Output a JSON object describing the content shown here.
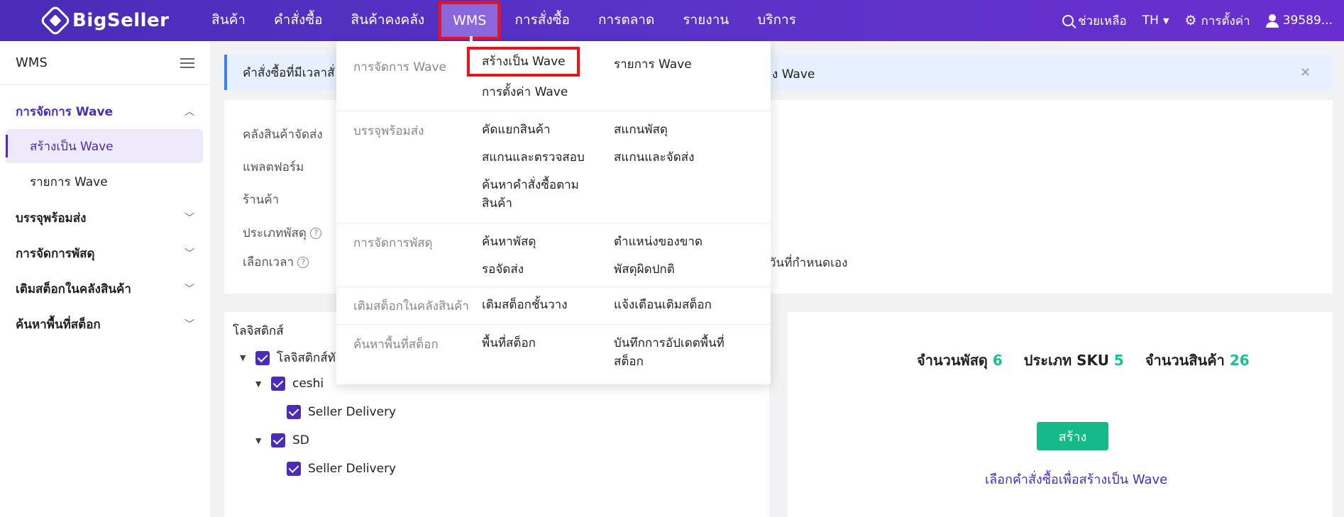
{
  "brand": "BigSeller",
  "nav": {
    "items": [
      "สินค้า",
      "คำสั่งซื้อ",
      "สินค้าคงคลัง",
      "WMS",
      "การสั่งซื้อ",
      "การตลาด",
      "รายงาน",
      "บริการ"
    ],
    "active": "WMS"
  },
  "topright": {
    "help": "ช่วยเหลือ",
    "lang": "TH",
    "settings": "การตั้งค่า",
    "user": "39589..."
  },
  "sidebar": {
    "title": "WMS",
    "groups": [
      {
        "label": "การจัดการ Wave",
        "open": true,
        "items": [
          "สร้างเป็น Wave",
          "รายการ Wave"
        ]
      },
      {
        "label": "บรรจุพร้อมส่ง"
      },
      {
        "label": "การจัดการพัสดุ"
      },
      {
        "label": "เติมสต็อกในคลังสินค้า"
      },
      {
        "label": "ค้นหาพื้นที่สต็อก"
      }
    ],
    "active_item": "สร้างเป็น Wave"
  },
  "alert": {
    "text": "คำสั่งซื้อที่มีเวลาสั่",
    "tail": "ง Wave"
  },
  "filters": {
    "warehouse": "คลังสินค้าจัดส่ง",
    "platform": "แพลตฟอร์ม",
    "shop": "ร้านค้า",
    "parcel_type": "ประเภทพัสดุ",
    "time": "เลือกเวลา",
    "custom_date": "วันที่กำหนดเอง"
  },
  "logistics": {
    "title": "โลจิสติกส์",
    "root": "โลจิสติกส์ทั",
    "carriers": [
      {
        "name": "ceshi",
        "child": "Seller Delivery"
      },
      {
        "name": "SD",
        "child": "Seller Delivery"
      }
    ]
  },
  "summary": {
    "parcels_label": "จำนวนพัสดุ",
    "parcels": "6",
    "sku_label": "ประเภท SKU",
    "sku": "5",
    "qty_label": "จำนวนสินค้า",
    "qty": "26",
    "create_button": "สร้าง",
    "hint": "เลือกคำสั่งซื้อเพื่อสร้างเป็น Wave"
  },
  "dropdown": {
    "sections": [
      {
        "category": "การจัดการ Wave",
        "links": [
          "สร้างเป็น Wave",
          "รายการ Wave",
          "การตั้งค่า Wave"
        ]
      },
      {
        "category": "บรรจุพร้อมส่ง",
        "links": [
          "คัดแยกสินค้า",
          "สแกนพัสดุ",
          "สแกนและตรวจสอบ",
          "สแกนและจัดส่ง",
          "ค้นหาคำสั่งซื้อตาม",
          "สินค้า"
        ]
      },
      {
        "category": "การจัดการพัสดุ",
        "links": [
          "ค้นหาพัสดุ",
          "ตำแหน่งของขาด",
          "รอจัดส่ง",
          "พัสดุผิดปกติ"
        ]
      },
      {
        "category": "เติมสต็อกในคลังสินค้า",
        "links": [
          "เติมสต็อกชั้นวาง",
          "แจ้งเตือนเติมสต็อก"
        ]
      },
      {
        "category": "ค้นหาพื้นที่สต็อก",
        "links": [
          "พื้นที่สต็อก",
          "บันทึกการอัปเดตพื้นที่",
          "สต็อก"
        ]
      }
    ]
  },
  "colors": {
    "primary": "#4a2cb8",
    "accent_green": "#16b98a",
    "highlight_red": "#e8141e"
  }
}
